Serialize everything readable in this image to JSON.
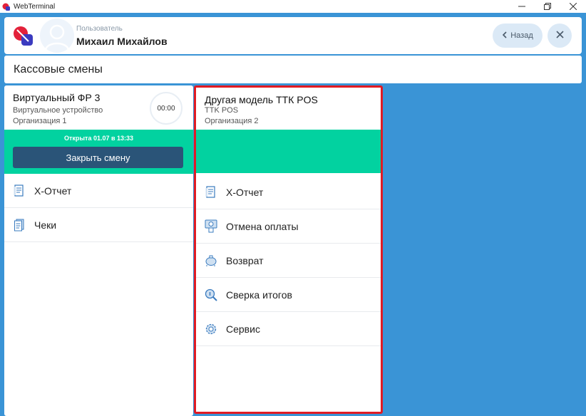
{
  "window": {
    "title": "WebTerminal"
  },
  "header": {
    "user_caption": "Пользователь",
    "user_name": "Михаил Михайлов",
    "back_label": "Назад"
  },
  "page": {
    "title": "Кассовые смены"
  },
  "colors": {
    "background": "#3a94d6",
    "green": "#02d2a0",
    "close_shift_button": "#2a5478",
    "highlight_border": "#e01b24"
  },
  "cards": [
    {
      "title": "Виртуальный ФР 3",
      "device": "Виртуальное устройство",
      "organization": "Организация 1",
      "timer": "00:00",
      "opened_text": "Открыта 01.07 в 13:33",
      "close_shift_label": "Закрыть смену",
      "menu": [
        {
          "label": "X-Отчет",
          "icon": "report-icon"
        },
        {
          "label": "Чеки",
          "icon": "receipts-icon"
        }
      ]
    },
    {
      "title": "Другая модель ТТК POS",
      "device": "TTK POS",
      "organization": "Организация 2",
      "menu": [
        {
          "label": "X-Отчет",
          "icon": "report-icon"
        },
        {
          "label": "Отмена оплаты",
          "icon": "cancel-payment-icon"
        },
        {
          "label": "Возврат",
          "icon": "refund-icon"
        },
        {
          "label": "Сверка итогов",
          "icon": "reconciliation-icon"
        },
        {
          "label": "Сервис",
          "icon": "gear-icon"
        }
      ]
    }
  ]
}
